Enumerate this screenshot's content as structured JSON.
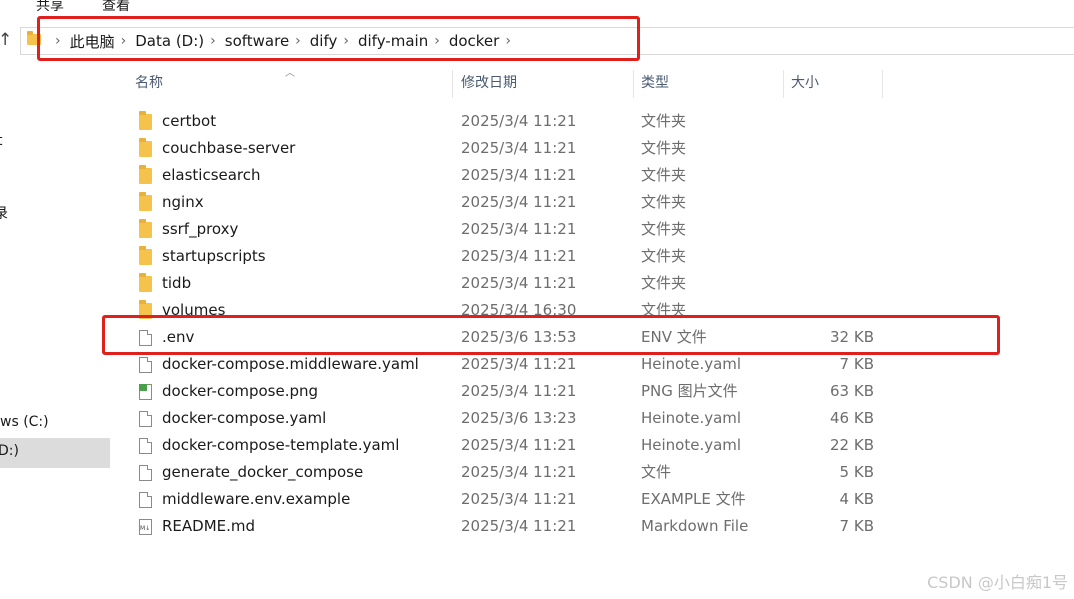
{
  "ribbon": {
    "tabs": [
      "共享",
      "查看"
    ]
  },
  "address_bar": {
    "crumbs": [
      "此电脑",
      "Data (D:)",
      "software",
      "dify",
      "dify-main",
      "docker"
    ]
  },
  "sidebar": {
    "items": [
      "t",
      "录",
      "ws (C:)",
      "D:)"
    ],
    "selected_index": 3
  },
  "columns": [
    "名称",
    "修改日期",
    "类型",
    "大小"
  ],
  "files": [
    {
      "name": "certbot",
      "date": "2025/3/4 11:21",
      "type": "文件夹",
      "size": "",
      "icon": "folder-icon"
    },
    {
      "name": "couchbase-server",
      "date": "2025/3/4 11:21",
      "type": "文件夹",
      "size": "",
      "icon": "folder-icon"
    },
    {
      "name": "elasticsearch",
      "date": "2025/3/4 11:21",
      "type": "文件夹",
      "size": "",
      "icon": "folder-icon"
    },
    {
      "name": "nginx",
      "date": "2025/3/4 11:21",
      "type": "文件夹",
      "size": "",
      "icon": "folder-icon"
    },
    {
      "name": "ssrf_proxy",
      "date": "2025/3/4 11:21",
      "type": "文件夹",
      "size": "",
      "icon": "folder-icon"
    },
    {
      "name": "startupscripts",
      "date": "2025/3/4 11:21",
      "type": "文件夹",
      "size": "",
      "icon": "folder-icon"
    },
    {
      "name": "tidb",
      "date": "2025/3/4 11:21",
      "type": "文件夹",
      "size": "",
      "icon": "folder-icon"
    },
    {
      "name": "volumes",
      "date": "2025/3/4 16:30",
      "type": "文件夹",
      "size": "",
      "icon": "folder-icon"
    },
    {
      "name": ".env",
      "date": "2025/3/6 13:53",
      "type": "ENV 文件",
      "size": "32 KB",
      "icon": "file-icon"
    },
    {
      "name": "docker-compose.middleware.yaml",
      "date": "2025/3/4 11:21",
      "type": "Heinote.yaml",
      "size": "7 KB",
      "icon": "file-icon"
    },
    {
      "name": "docker-compose.png",
      "date": "2025/3/4 11:21",
      "type": "PNG 图片文件",
      "size": "63 KB",
      "icon": "image-file-icon"
    },
    {
      "name": "docker-compose.yaml",
      "date": "2025/3/6 13:23",
      "type": "Heinote.yaml",
      "size": "46 KB",
      "icon": "file-icon"
    },
    {
      "name": "docker-compose-template.yaml",
      "date": "2025/3/4 11:21",
      "type": "Heinote.yaml",
      "size": "22 KB",
      "icon": "file-icon"
    },
    {
      "name": "generate_docker_compose",
      "date": "2025/3/4 11:21",
      "type": "文件",
      "size": "5 KB",
      "icon": "file-icon"
    },
    {
      "name": "middleware.env.example",
      "date": "2025/3/4 11:21",
      "type": "EXAMPLE 文件",
      "size": "4 KB",
      "icon": "file-icon"
    },
    {
      "name": "README.md",
      "date": "2025/3/4 11:21",
      "type": "Markdown File",
      "size": "7 KB",
      "icon": "markdown-file-icon"
    }
  ],
  "highlighted_file": ".env",
  "highlight_color": "#e0201c",
  "watermark": "CSDN @小白痴1号"
}
